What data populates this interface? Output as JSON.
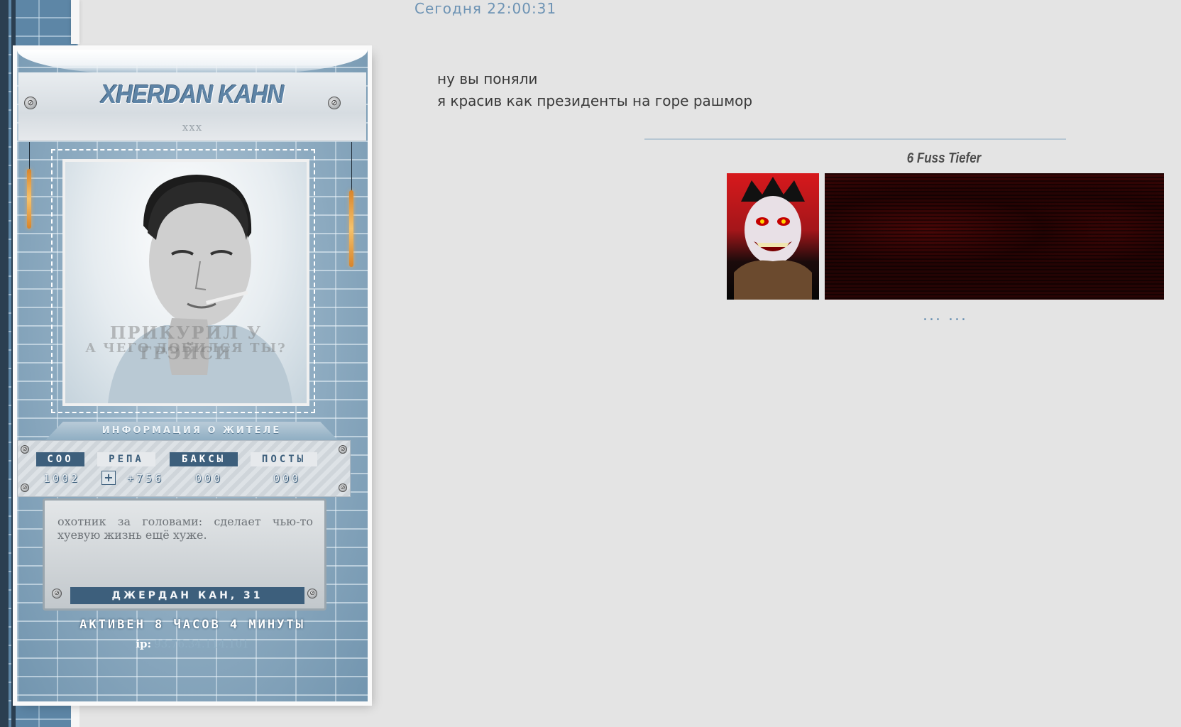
{
  "post": {
    "timestamp": "Сегодня 22:00:31",
    "lines": [
      "ну вы поняли",
      "я красив как президенты на горе рашмор"
    ]
  },
  "profile": {
    "name": "XHERDAN KAHN",
    "subtitle": "xxx",
    "avatar_overlay": [
      "ПРИКУРИЛ У ГРЭЙСИ",
      "А ЧЕГО ДОБИЛСЯ ТЫ?"
    ],
    "info_banner": "ИНФОРМАЦИЯ О ЖИТЕЛЕ",
    "stats": {
      "labels": [
        "СОО",
        "РЕПА",
        "БАКСЫ",
        "ПОСТЫ"
      ],
      "values": [
        "1002",
        "+756",
        "000",
        "000"
      ],
      "plus_symbol": "+"
    },
    "description": "охотник за головами: сделает чью-то хуевую жизнь ещё хуже.",
    "character": "ДЖЕРДАН КАН, 31",
    "active": "АКТИВЕН 8 ЧАСОВ 4 МИНУТЫ",
    "ip_label": "ip:",
    "ip_value": "93.76.34.114.101"
  },
  "signature": {
    "title": "6 Fuss Tiefer",
    "dots": "... ..."
  },
  "colors": {
    "accent": "#3d5f7c",
    "timestamp": "#6d93b4",
    "background": "#e4e4e4"
  }
}
